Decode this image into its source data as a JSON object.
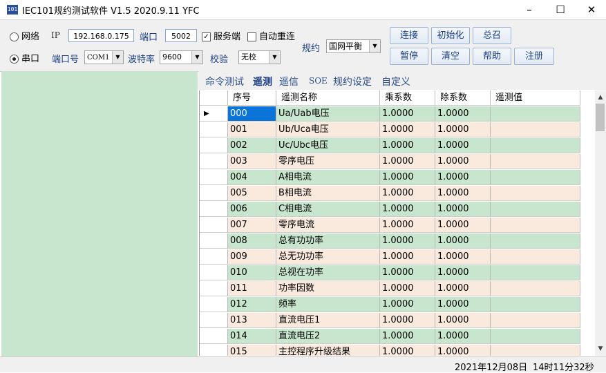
{
  "window": {
    "icon_text": "101",
    "title": "IEC101规约测试软件  V1.5 2020.9.11   YFC",
    "minimize": "–",
    "maximize": "☐",
    "close": "✕"
  },
  "connection": {
    "network_label": "网络",
    "ip_label": "IP",
    "ip_value": "192.168.0.175",
    "port_label": "端口",
    "port_value": "5002",
    "server_label": "服务端",
    "server_checked": "✓",
    "reconnect_label": "自动重连",
    "serial_label": "串口",
    "portno_label": "端口号",
    "portno_value": "COM1",
    "baud_label": "波特率",
    "baud_value": "9600",
    "parity_label": "校验",
    "parity_value": "无校",
    "protocol_label": "规约",
    "protocol_value": "国网平衡",
    "combo_arrow": "▼"
  },
  "buttons": {
    "connect": "连接",
    "init": "初始化",
    "general_call": "总召",
    "pause": "暂停",
    "clear": "清空",
    "help": "帮助",
    "register": "注册"
  },
  "tabs": [
    "命令测试",
    "遥测",
    "遥信",
    "SOE",
    "规约设定",
    "自定义"
  ],
  "table": {
    "columns": [
      "序号",
      "遥测名称",
      "乘系数",
      "除系数",
      "遥测值"
    ],
    "current_marker": "▶",
    "rows": [
      [
        "000",
        "Ua/Uab电压",
        "1.0000",
        "1.0000",
        ""
      ],
      [
        "001",
        "Ub/Uca电压",
        "1.0000",
        "1.0000",
        ""
      ],
      [
        "002",
        "Uc/Ubc电压",
        "1.0000",
        "1.0000",
        ""
      ],
      [
        "003",
        "零序电压",
        "1.0000",
        "1.0000",
        ""
      ],
      [
        "004",
        "A相电流",
        "1.0000",
        "1.0000",
        ""
      ],
      [
        "005",
        "B相电流",
        "1.0000",
        "1.0000",
        ""
      ],
      [
        "006",
        "C相电流",
        "1.0000",
        "1.0000",
        ""
      ],
      [
        "007",
        "零序电流",
        "1.0000",
        "1.0000",
        ""
      ],
      [
        "008",
        "总有功功率",
        "1.0000",
        "1.0000",
        ""
      ],
      [
        "009",
        "总无功功率",
        "1.0000",
        "1.0000",
        ""
      ],
      [
        "010",
        "总视在功率",
        "1.0000",
        "1.0000",
        ""
      ],
      [
        "011",
        "功率因数",
        "1.0000",
        "1.0000",
        ""
      ],
      [
        "012",
        "频率",
        "1.0000",
        "1.0000",
        ""
      ],
      [
        "013",
        "直流电压1",
        "1.0000",
        "1.0000",
        ""
      ],
      [
        "014",
        "直流电压2",
        "1.0000",
        "1.0000",
        ""
      ],
      [
        "015",
        "主控程序升级结果",
        "1.0000",
        "1.0000",
        ""
      ]
    ]
  },
  "scrollbar": {
    "up": "▲",
    "down": "▼"
  },
  "status": {
    "date": "2021年12月08日",
    "time": "14时11分32秒"
  },
  "colors": {
    "green_row": "#c7e6cd",
    "beige_row": "#fae9dd",
    "selected": "#0a74d9",
    "left_panel": "#c7e6cd"
  }
}
